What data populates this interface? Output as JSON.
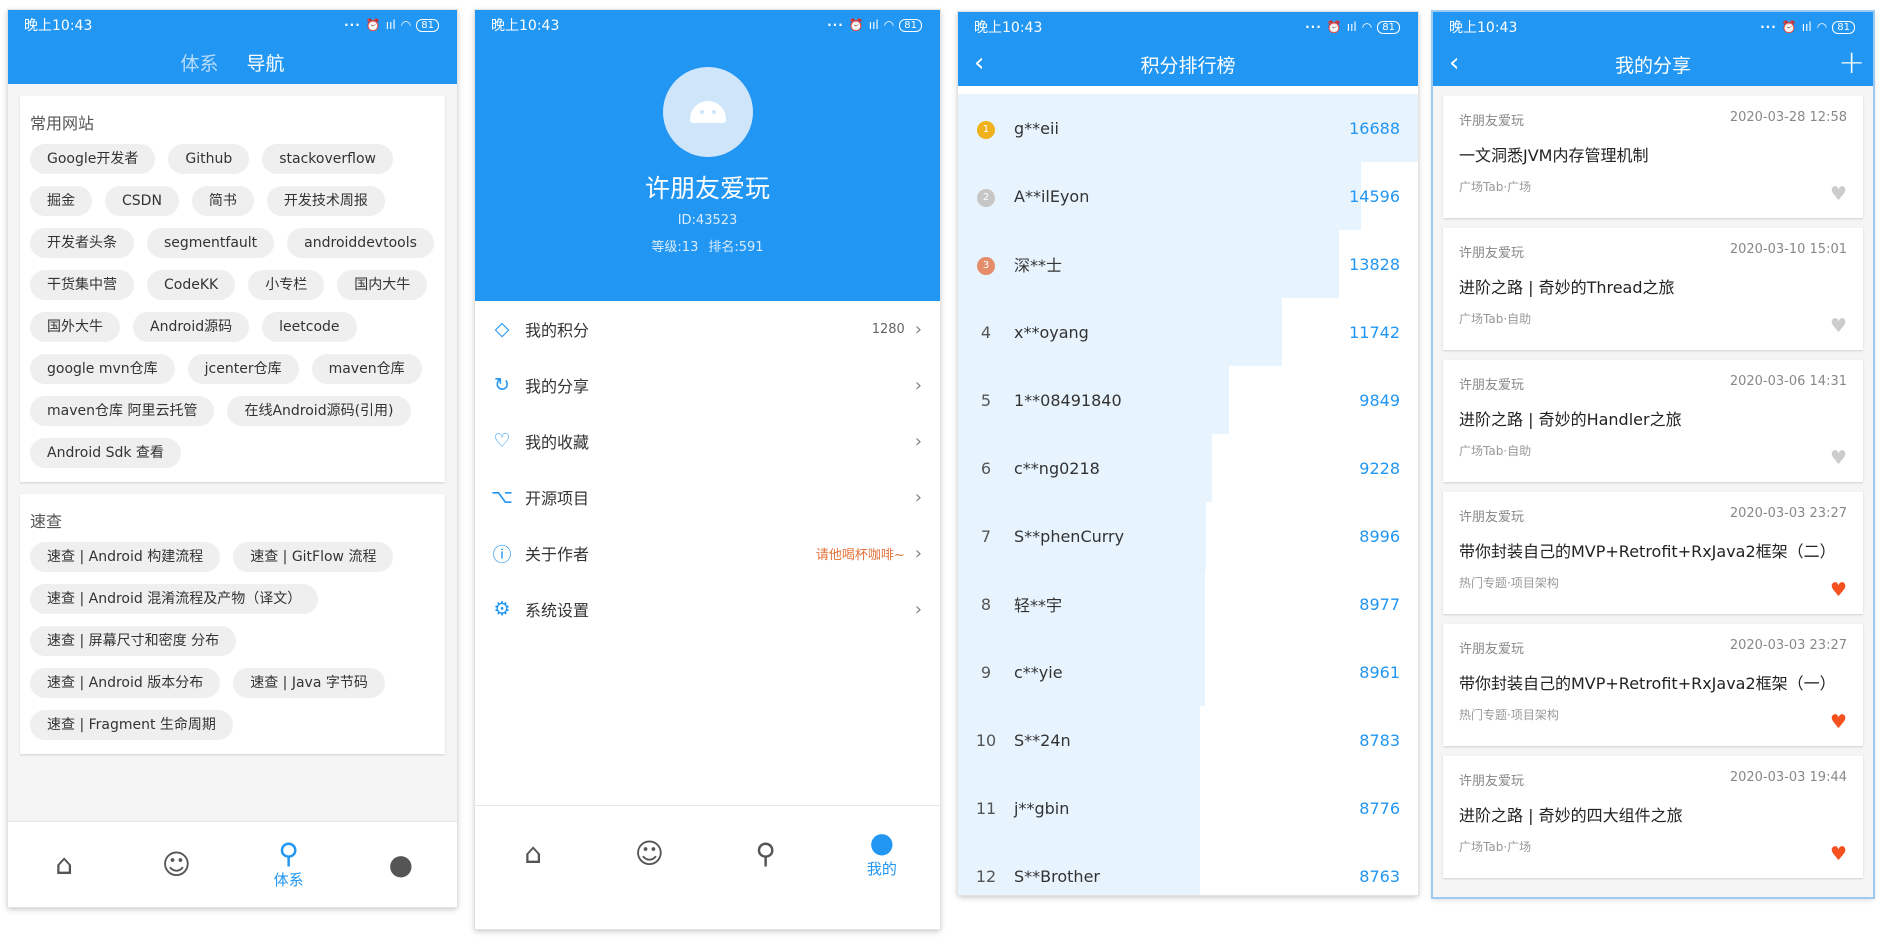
{
  "status": {
    "time1": "晚上10:43",
    "time2": "晚上10:43",
    "time3": "晚上10:43",
    "time4": "晚上10:43",
    "signal": "ııl",
    "battery": "81"
  },
  "system": {
    "tabs": [
      "体系",
      "导航"
    ],
    "sections": [
      {
        "title": "常用网站",
        "links": [
          "Google开发者",
          "Github",
          "stackoverflow",
          "掘金",
          "CSDN",
          "简书",
          "开发技术周报",
          "开发者头条",
          "segmentfault",
          "androiddevtools",
          "干货集中营",
          "CodeKK",
          "小专栏",
          "国内大牛",
          "国外大牛",
          "Android源码",
          "leetcode",
          "google mvn仓库",
          "jcenter仓库",
          "maven仓库",
          "maven仓库 阿里云托管",
          "在线Android源码(引用)",
          "Android Sdk 查看"
        ]
      },
      {
        "title": "速查",
        "links": [
          "速查 | Android 构建流程",
          "速查 | GitFlow 流程",
          "速查 | Android 混淆流程及产物（译文）",
          "速查 | 屏幕尺寸和密度 分布",
          "速查 | Android 版本分布",
          "速查 | Java 字节码",
          "速查 | Fragment 生命周期"
        ]
      }
    ],
    "nav_label": "体系"
  },
  "mine": {
    "name": "许朋友爱玩",
    "id": "ID:43523",
    "level": "等级:13",
    "rank": "排名:591",
    "menu": [
      {
        "icon": "diamond-icon",
        "glyph": "◇",
        "label": "我的积分",
        "value": "1280"
      },
      {
        "icon": "share-icon",
        "glyph": "↻",
        "label": "我的分享",
        "value": ""
      },
      {
        "icon": "heart-icon",
        "glyph": "♡",
        "label": "我的收藏",
        "value": ""
      },
      {
        "icon": "github-icon",
        "glyph": "⌥",
        "label": "开源项目",
        "value": ""
      },
      {
        "icon": "info-icon",
        "glyph": "ⓘ",
        "label": "关于作者",
        "value": "请他喝杯咖啡~"
      },
      {
        "icon": "settings-icon",
        "glyph": "⚙",
        "label": "系统设置",
        "value": ""
      }
    ],
    "nav_label": "我的"
  },
  "ranking": {
    "title": "积分排行榜",
    "rows": [
      {
        "rank": "",
        "medal": "gold",
        "name": "g**eii",
        "score": "16688",
        "ratio": 1.0
      },
      {
        "rank": "",
        "medal": "silver",
        "name": "A**ilEyon",
        "score": "14596",
        "ratio": 0.875
      },
      {
        "rank": "",
        "medal": "bronze",
        "name": "深**士",
        "score": "13828",
        "ratio": 0.829
      },
      {
        "rank": "4",
        "medal": "",
        "name": "x**oyang",
        "score": "11742",
        "ratio": 0.704
      },
      {
        "rank": "5",
        "medal": "",
        "name": "1**08491840",
        "score": "9849",
        "ratio": 0.59
      },
      {
        "rank": "6",
        "medal": "",
        "name": "c**ng0218",
        "score": "9228",
        "ratio": 0.553
      },
      {
        "rank": "7",
        "medal": "",
        "name": "S**phenCurry",
        "score": "8996",
        "ratio": 0.539
      },
      {
        "rank": "8",
        "medal": "",
        "name": "轻**宇",
        "score": "8977",
        "ratio": 0.538
      },
      {
        "rank": "9",
        "medal": "",
        "name": "c**yie",
        "score": "8961",
        "ratio": 0.537
      },
      {
        "rank": "10",
        "medal": "",
        "name": "S**24n",
        "score": "8783",
        "ratio": 0.526
      },
      {
        "rank": "11",
        "medal": "",
        "name": "j**gbin",
        "score": "8776",
        "ratio": 0.526
      },
      {
        "rank": "12",
        "medal": "",
        "name": "S**Brother",
        "score": "8763",
        "ratio": 0.525
      }
    ]
  },
  "share": {
    "title": "我的分享",
    "items": [
      {
        "author": "许朋友爱玩",
        "date": "2020-03-28 12:58",
        "title": "一文洞悉JVM内存管理机制",
        "tag": "广场Tab·广场",
        "liked": false
      },
      {
        "author": "许朋友爱玩",
        "date": "2020-03-10 15:01",
        "title": "进阶之路 | 奇妙的Thread之旅",
        "tag": "广场Tab·自助",
        "liked": false
      },
      {
        "author": "许朋友爱玩",
        "date": "2020-03-06 14:31",
        "title": "进阶之路 | 奇妙的Handler之旅",
        "tag": "广场Tab·自助",
        "liked": false
      },
      {
        "author": "许朋友爱玩",
        "date": "2020-03-03 23:27",
        "title": "带你封装自己的MVP+Retrofit+RxJava2框架（二）",
        "tag": "热门专题·项目架构",
        "liked": true
      },
      {
        "author": "许朋友爱玩",
        "date": "2020-03-03 23:27",
        "title": "带你封装自己的MVP+Retrofit+RxJava2框架（一）",
        "tag": "热门专题·项目架构",
        "liked": true
      },
      {
        "author": "许朋友爱玩",
        "date": "2020-03-03 19:44",
        "title": "进阶之路 | 奇妙的四大组件之旅",
        "tag": "广场Tab·广场",
        "liked": true
      }
    ]
  },
  "colors": {
    "primary": "#2196f3",
    "liked": "#f4511e",
    "gold": "#f0b21b",
    "silver": "#c6c6c6",
    "bronze": "#e58c6a"
  }
}
